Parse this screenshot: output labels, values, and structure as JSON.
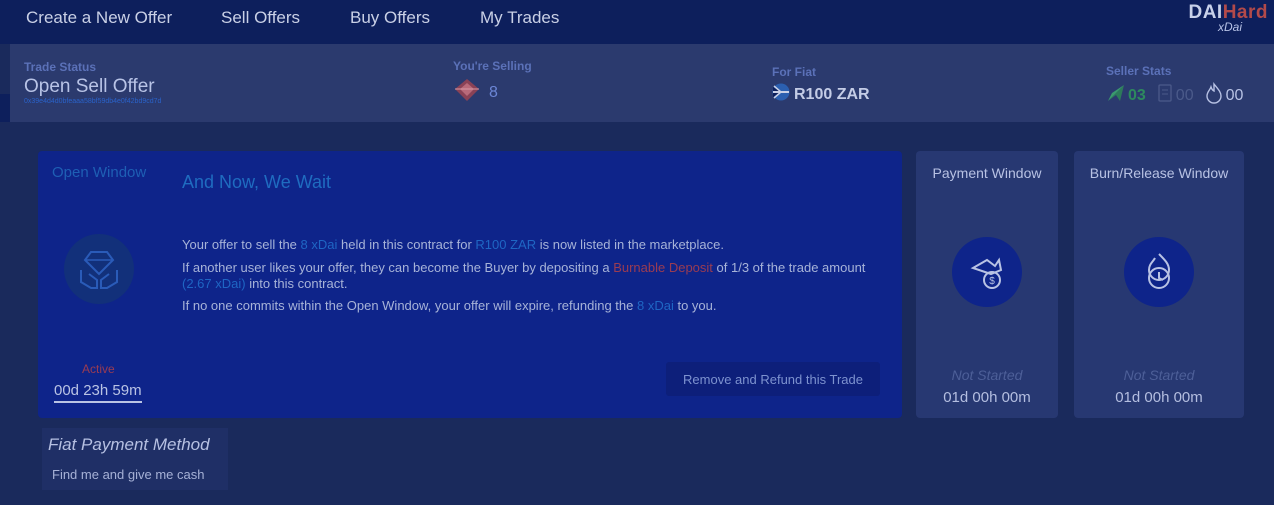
{
  "nav": {
    "items": [
      "Create a New Offer",
      "Sell Offers",
      "Buy Offers",
      "My Trades"
    ],
    "logo_main": "DAI",
    "logo_accent": "Hard",
    "logo_sub": "xDai"
  },
  "status": {
    "trade_status_label": "Trade Status",
    "trade_status_value": "Open Sell Offer",
    "contract_address": "0x39e4d4d0bfeaaa58bf59db4e0f42bd9cd7d",
    "selling_label": "You're Selling",
    "selling_value": "8",
    "fiat_label": "For Fiat",
    "fiat_value": "R100 ZAR",
    "seller_stats_label": "Seller Stats",
    "stats": [
      "03",
      "00",
      "00"
    ]
  },
  "open_window": {
    "label": "Open Window",
    "headline": "And Now, We Wait",
    "p1_a": "Your offer to sell the ",
    "p1_amount": "8 xDai",
    "p1_b": " held in this contract for ",
    "p1_fiat": "R100 ZAR",
    "p1_c": " is now listed in the marketplace.",
    "p2_a": "If another user likes your offer, they can become the Buyer by depositing a ",
    "p2_deposit": "Burnable Deposit",
    "p2_b": " of 1/3 of the trade amount ",
    "p2_amount": "(2.67 xDai)",
    "p2_c": " into this contract.",
    "p3_a": "If no one commits within the Open Window, your offer will expire, refunding the ",
    "p3_amount": "8 xDai",
    "p3_b": " to you.",
    "active_label": "Active",
    "timer": "00d 23h 59m",
    "refund_button": "Remove and Refund this Trade"
  },
  "payment_window": {
    "title": "Payment Window",
    "status": "Not Started",
    "timer": "01d 00h 00m"
  },
  "burn_window": {
    "title": "Burn/Release Window",
    "status": "Not Started",
    "timer": "01d 00h 00m"
  },
  "fiat_method": {
    "title": "Fiat Payment Method",
    "description": "Find me and give me cash"
  },
  "colors": {
    "nav_bg": "#0d1f5c",
    "card_main": "#0e248a",
    "accent_blue": "#1f66c4",
    "accent_red": "#9a3c52"
  }
}
